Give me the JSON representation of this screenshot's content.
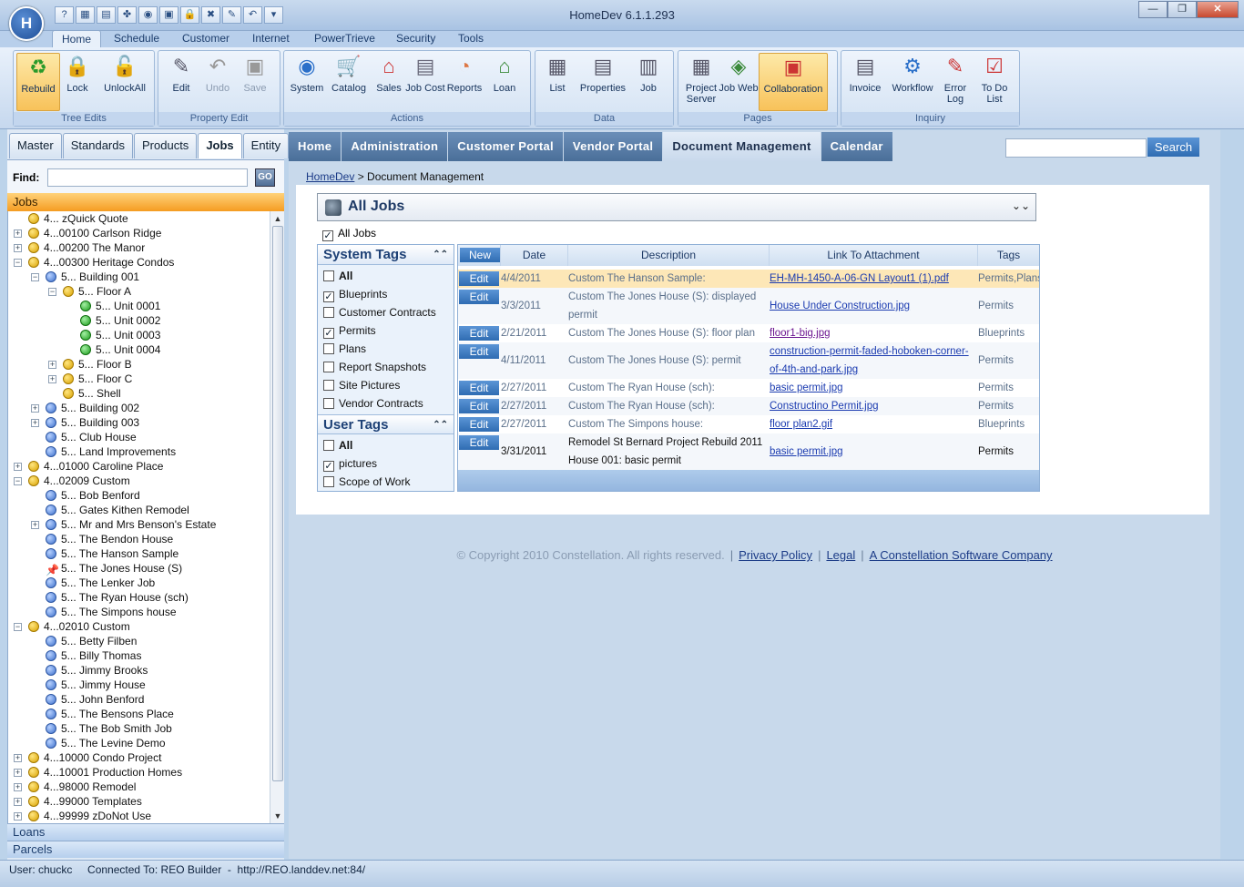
{
  "app": {
    "title": "HomeDev 6.1.1.293",
    "logo_text": "H"
  },
  "window_buttons": {
    "minimize": "—",
    "restore": "❐",
    "close": "✕"
  },
  "qat_icons": [
    "?",
    "▦",
    "▤",
    "✤",
    "◉",
    "▣",
    "🔒",
    "✖",
    "✎",
    "↶",
    "▾"
  ],
  "ribbon_tabs": [
    "Home",
    "Schedule",
    "Customer",
    "Internet",
    "PowerTrieve",
    "Security",
    "Tools"
  ],
  "ribbon": {
    "tree_edits": {
      "label": "Tree Edits",
      "buttons": [
        "Rebuild",
        "Lock",
        "UnlockAll"
      ]
    },
    "property_edit": {
      "label": "Property Edit",
      "buttons": [
        "Edit",
        "Undo",
        "Save"
      ]
    },
    "actions": {
      "label": "Actions",
      "buttons": [
        "System",
        "Catalog",
        "Sales",
        "Job Cost",
        "Reports",
        "Loan"
      ]
    },
    "data": {
      "label": "Data",
      "buttons": [
        "List",
        "Properties",
        "Job"
      ]
    },
    "pages": {
      "label": "Pages",
      "buttons": [
        "Project Server",
        "Job Web",
        "Collaboration"
      ]
    },
    "inquiry": {
      "label": "Inquiry",
      "buttons": [
        "Invoice",
        "Workflow",
        "Error Log",
        "To Do List"
      ]
    }
  },
  "left_tabs": [
    "Master",
    "Standards",
    "Products",
    "Jobs",
    "Entity"
  ],
  "find": {
    "label": "Find:",
    "go": "GO",
    "value": ""
  },
  "jobs_header": "Jobs",
  "tree": [
    {
      "text": "4... zQuick Quote",
      "level": 0,
      "icon": "y",
      "exp": ""
    },
    {
      "text": "4...00100 Carlson Ridge",
      "level": 0,
      "icon": "y",
      "exp": "+"
    },
    {
      "text": "4...00200 The Manor",
      "level": 0,
      "icon": "y",
      "exp": "+"
    },
    {
      "text": "4...00300 Heritage Condos",
      "level": 0,
      "icon": "y",
      "exp": "−"
    },
    {
      "text": "5... Building 001",
      "level": 1,
      "icon": "b",
      "exp": "−"
    },
    {
      "text": "5... Floor A",
      "level": 2,
      "icon": "y",
      "exp": "−"
    },
    {
      "text": "5... Unit 0001",
      "level": 3,
      "icon": "g",
      "exp": ""
    },
    {
      "text": "5... Unit 0002",
      "level": 3,
      "icon": "g",
      "exp": ""
    },
    {
      "text": "5... Unit 0003",
      "level": 3,
      "icon": "g",
      "exp": ""
    },
    {
      "text": "5... Unit 0004",
      "level": 3,
      "icon": "g",
      "exp": ""
    },
    {
      "text": "5... Floor B",
      "level": 2,
      "icon": "y",
      "exp": "+"
    },
    {
      "text": "5... Floor C",
      "level": 2,
      "icon": "y",
      "exp": "+"
    },
    {
      "text": "5... Shell",
      "level": 2,
      "icon": "y",
      "exp": ""
    },
    {
      "text": "5... Building 002",
      "level": 1,
      "icon": "b",
      "exp": "+"
    },
    {
      "text": "5... Building 003",
      "level": 1,
      "icon": "b",
      "exp": "+"
    },
    {
      "text": "5... Club House",
      "level": 1,
      "icon": "b",
      "exp": ""
    },
    {
      "text": "5... Land Improvements",
      "level": 1,
      "icon": "b",
      "exp": ""
    },
    {
      "text": "4...01000 Caroline Place",
      "level": 0,
      "icon": "y",
      "exp": "+"
    },
    {
      "text": "4...02009 Custom",
      "level": 0,
      "icon": "y",
      "exp": "−"
    },
    {
      "text": "5... Bob Benford",
      "level": 1,
      "icon": "b",
      "exp": ""
    },
    {
      "text": "5... Gates Kithen Remodel",
      "level": 1,
      "icon": "b",
      "exp": ""
    },
    {
      "text": "5... Mr and Mrs Benson's Estate",
      "level": 1,
      "icon": "b",
      "exp": "+"
    },
    {
      "text": "5... The Bendon House",
      "level": 1,
      "icon": "b",
      "exp": ""
    },
    {
      "text": "5... The Hanson Sample",
      "level": 1,
      "icon": "b",
      "exp": ""
    },
    {
      "text": "5... The Jones House (S)",
      "level": 1,
      "icon": "pin",
      "exp": ""
    },
    {
      "text": "5... The Lenker Job",
      "level": 1,
      "icon": "b",
      "exp": ""
    },
    {
      "text": "5... The Ryan House (sch)",
      "level": 1,
      "icon": "b",
      "exp": ""
    },
    {
      "text": "5... The Simpons house",
      "level": 1,
      "icon": "b",
      "exp": ""
    },
    {
      "text": "4...02010 Custom",
      "level": 0,
      "icon": "y",
      "exp": "−"
    },
    {
      "text": "5... Betty Filben",
      "level": 1,
      "icon": "b",
      "exp": ""
    },
    {
      "text": "5... Billy Thomas",
      "level": 1,
      "icon": "b",
      "exp": ""
    },
    {
      "text": "5... Jimmy Brooks",
      "level": 1,
      "icon": "b",
      "exp": ""
    },
    {
      "text": "5... Jimmy House",
      "level": 1,
      "icon": "b",
      "exp": ""
    },
    {
      "text": "5... John Benford",
      "level": 1,
      "icon": "b",
      "exp": ""
    },
    {
      "text": "5... The Bensons Place",
      "level": 1,
      "icon": "b",
      "exp": ""
    },
    {
      "text": "5... The Bob Smith Job",
      "level": 1,
      "icon": "b",
      "exp": ""
    },
    {
      "text": "5... The Levine Demo",
      "level": 1,
      "icon": "b",
      "exp": ""
    },
    {
      "text": "4...10000 Condo Project",
      "level": 0,
      "icon": "y",
      "exp": "+"
    },
    {
      "text": "4...10001 Production Homes",
      "level": 0,
      "icon": "y",
      "exp": "+"
    },
    {
      "text": "4...98000 Remodel",
      "level": 0,
      "icon": "y",
      "exp": "+"
    },
    {
      "text": "4...99000 Templates",
      "level": 0,
      "icon": "y",
      "exp": "+"
    },
    {
      "text": "4...99999 zDoNot Use",
      "level": 0,
      "icon": "y",
      "exp": "+"
    }
  ],
  "left_bottom": [
    "Loans",
    "Parcels"
  ],
  "status": {
    "text": "User: chuckc     Connected To: REO Builder  -  http://REO.landdev.net:84/"
  },
  "nav_tabs": [
    "Home",
    "Administration",
    "Customer Portal",
    "Vendor Portal",
    "Document Management",
    "Calendar"
  ],
  "search": {
    "button": "Search",
    "value": ""
  },
  "breadcrumb": {
    "link": "HomeDev",
    "sep": " > ",
    "current": "Document Management"
  },
  "job_selector": {
    "title": "All Jobs",
    "checkbox_label": "All Jobs"
  },
  "system_tags": {
    "title": "System Tags",
    "items": [
      {
        "label": "All",
        "checked": false,
        "bold": true
      },
      {
        "label": "Blueprints",
        "checked": true
      },
      {
        "label": "Customer Contracts",
        "checked": false
      },
      {
        "label": "Permits",
        "checked": true
      },
      {
        "label": "Plans",
        "checked": false
      },
      {
        "label": "Report Snapshots",
        "checked": false
      },
      {
        "label": "Site Pictures",
        "checked": false
      },
      {
        "label": "Vendor Contracts",
        "checked": false
      }
    ]
  },
  "user_tags": {
    "title": "User Tags",
    "items": [
      {
        "label": "All",
        "checked": false,
        "bold": true
      },
      {
        "label": "pictures",
        "checked": true
      },
      {
        "label": "Scope of Work",
        "checked": false
      }
    ]
  },
  "grid": {
    "new_label": "New",
    "edit_label": "Edit",
    "headers": [
      "Date",
      "Description",
      "Link To Attachment",
      "Tags"
    ],
    "rows": [
      {
        "date": "4/4/2011",
        "desc": [
          "Custom The Hanson Sample:"
        ],
        "link": [
          "EH-MH-1450-A-06-GN Layout1 (1).pdf"
        ],
        "tags": "Permits,Plans",
        "style": "hl"
      },
      {
        "date": "3/3/2011",
        "desc": [
          "Custom The Jones House (S): displayed",
          "permit"
        ],
        "link": [
          "House Under Construction.jpg"
        ],
        "tags": "Permits",
        "style": "alt"
      },
      {
        "date": "2/21/2011",
        "desc": [
          "Custom The Jones House (S): floor plan"
        ],
        "link": [
          "floor1-big.jpg"
        ],
        "tags": "Blueprints",
        "style": "",
        "visited": true
      },
      {
        "date": "4/11/2011",
        "desc": [
          "Custom The Jones House (S): permit"
        ],
        "link": [
          "construction-permit-faded-hoboken-corner-",
          "of-4th-and-park.jpg"
        ],
        "tags": "Permits",
        "style": "alt"
      },
      {
        "date": "2/27/2011",
        "desc": [
          "Custom The Ryan House (sch):"
        ],
        "link": [
          "basic permit.jpg"
        ],
        "tags": "Permits",
        "style": ""
      },
      {
        "date": "2/27/2011",
        "desc": [
          "Custom The Ryan House (sch):"
        ],
        "link": [
          "Constructino Permit.jpg"
        ],
        "tags": "Permits",
        "style": "alt"
      },
      {
        "date": "2/27/2011",
        "desc": [
          "Custom The Simpons house:"
        ],
        "link": [
          "floor plan2.gif"
        ],
        "tags": "Blueprints",
        "style": ""
      },
      {
        "date": "3/31/2011",
        "desc": [
          "Remodel St Bernard Project Rebuild 2011",
          "House 001: basic permit"
        ],
        "link": [
          "basic permit.jpg"
        ],
        "tags": "Permits",
        "style": "alt",
        "dark": true
      }
    ]
  },
  "footer": {
    "copyright": "© Copyright 2010 Constellation. All rights reserved.",
    "links": [
      "Privacy Policy",
      "Legal",
      "A Constellation Software Company"
    ]
  }
}
